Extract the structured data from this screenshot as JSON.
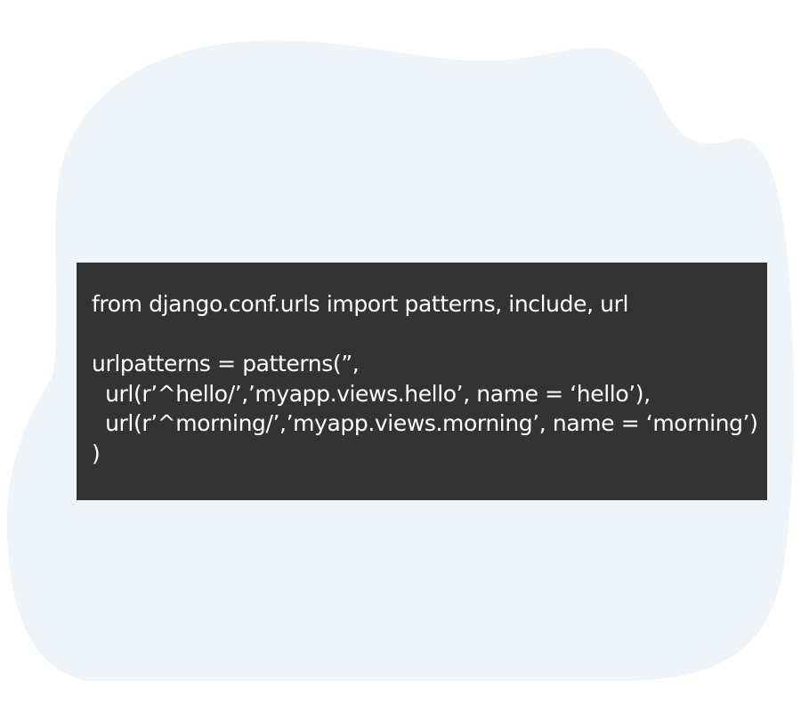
{
  "code": {
    "lines": [
      "from django.conf.urls import patterns, include, url",
      "",
      "urlpatterns = patterns(”,",
      "  url(r’^hello/’,’myapp.views.hello’, name = ‘hello’),",
      "  url(r’^morning/’,’myapp.views.morning’, name = ‘morning’)",
      ")"
    ]
  },
  "colors": {
    "blob": "#eff4f9",
    "code_background": "#333333",
    "code_text": "#ffffff"
  }
}
